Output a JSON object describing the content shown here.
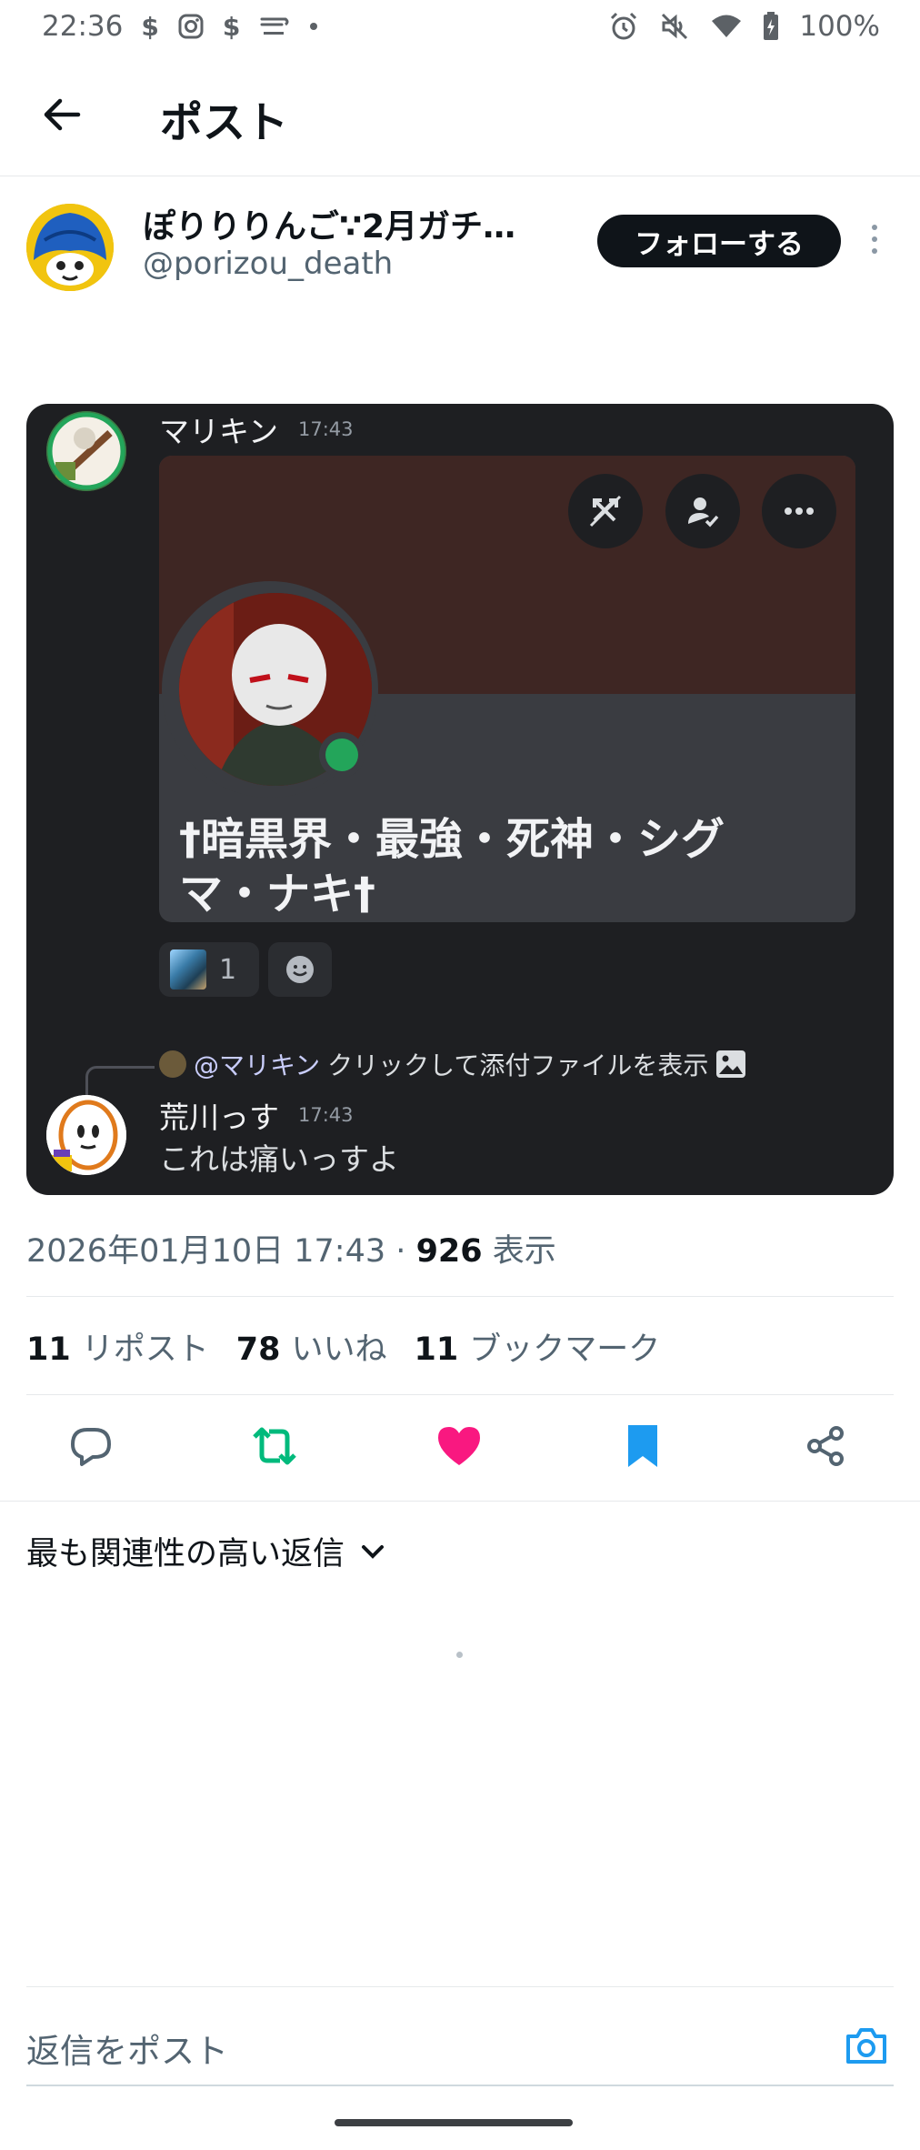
{
  "status_bar": {
    "time": "22:36",
    "battery": "100%",
    "left_icons": [
      "s-icon",
      "instagram-icon",
      "s-icon",
      "saison-icon",
      "dot-icon"
    ],
    "right_icons": [
      "alarm-icon",
      "mute-icon",
      "wifi-icon",
      "battery-icon"
    ]
  },
  "header": {
    "title": "ポスト"
  },
  "author": {
    "name": "ぽりりりんご∵2月ガチ…",
    "handle": "@porizou_death",
    "follow_label": "フォローする"
  },
  "media": {
    "message1": {
      "user": "マリキン",
      "time": "17:43"
    },
    "card": {
      "name": "†暗黒界・最強・死神・シグマ・ナキ†",
      "buttons": [
        "swords-off-icon",
        "user-check-icon",
        "more-icon"
      ]
    },
    "reaction": {
      "count": "1"
    },
    "reply_ref": {
      "mention": "@マリキン",
      "text": "クリックして添付ファイルを表示"
    },
    "message2": {
      "user": "荒川っす",
      "time": "17:43",
      "text": "これは痛いっすよ"
    }
  },
  "meta": {
    "date": "2026年01月10日 17:43",
    "separator": "·",
    "views": "926",
    "views_label": "表示"
  },
  "stats": [
    {
      "count": "11",
      "label": "リポスト"
    },
    {
      "count": "78",
      "label": "いいね"
    },
    {
      "count": "11",
      "label": "ブックマーク"
    }
  ],
  "actions": [
    "reply-icon",
    "repost-icon",
    "like-icon",
    "bookmark-icon",
    "share-icon"
  ],
  "colors": {
    "repost": "#00ba7c",
    "like": "#f91880",
    "bookmark": "#1d9bf0",
    "follow_bg": "#0f1419"
  },
  "sort": {
    "label": "最も関連性の高い返信"
  },
  "reply": {
    "placeholder": "返信をポスト"
  }
}
